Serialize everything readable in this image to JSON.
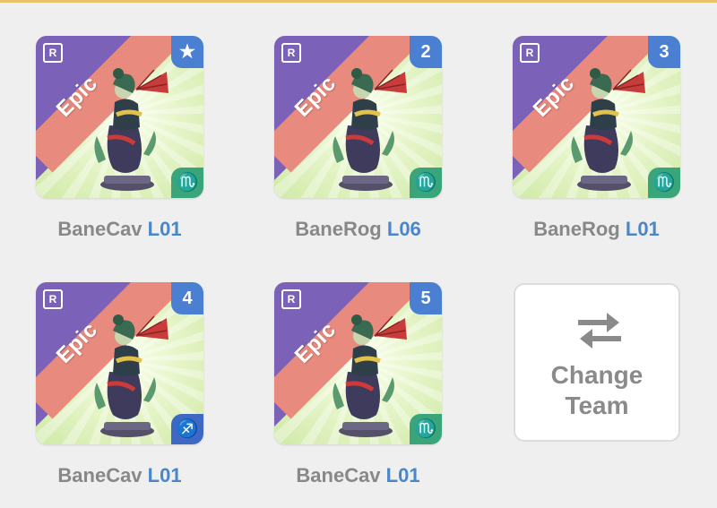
{
  "colors": {
    "background": "#efefef",
    "epic_band": "#e88a7d",
    "purple_band": "#7b62b8",
    "slot_badge": "#4a7fd2",
    "name_text": "#888888",
    "level_text": "#4a86c8"
  },
  "cards": [
    {
      "rarity": "Epic",
      "r_badge": "R",
      "slot_badge": "★",
      "slot_icon": "star-icon",
      "sign_icon": "scorpio-icon",
      "sign_glyph": "♏",
      "sign_color": "#3aa57a",
      "name": "BaneCav",
      "level": "L01"
    },
    {
      "rarity": "Epic",
      "r_badge": "R",
      "slot_badge": "2",
      "slot_icon": "",
      "sign_icon": "scorpio-icon",
      "sign_glyph": "♏",
      "sign_color": "#3aa57a",
      "name": "BaneRog",
      "level": "L06"
    },
    {
      "rarity": "Epic",
      "r_badge": "R",
      "slot_badge": "3",
      "slot_icon": "",
      "sign_icon": "scorpio-icon",
      "sign_glyph": "♏",
      "sign_color": "#3aa57a",
      "name": "BaneRog",
      "level": "L01"
    },
    {
      "rarity": "Epic",
      "r_badge": "R",
      "slot_badge": "4",
      "slot_icon": "",
      "sign_icon": "sagittarius-icon",
      "sign_glyph": "♐",
      "sign_color": "#3d69c4",
      "name": "BaneCav",
      "level": "L01"
    },
    {
      "rarity": "Epic",
      "r_badge": "R",
      "slot_badge": "5",
      "slot_icon": "",
      "sign_icon": "scorpio-icon",
      "sign_glyph": "♏",
      "sign_color": "#3aa57a",
      "name": "BaneCav",
      "level": "L01"
    }
  ],
  "change_team": {
    "line1": "Change",
    "line2": "Team",
    "icon": "swap-arrows-icon"
  }
}
